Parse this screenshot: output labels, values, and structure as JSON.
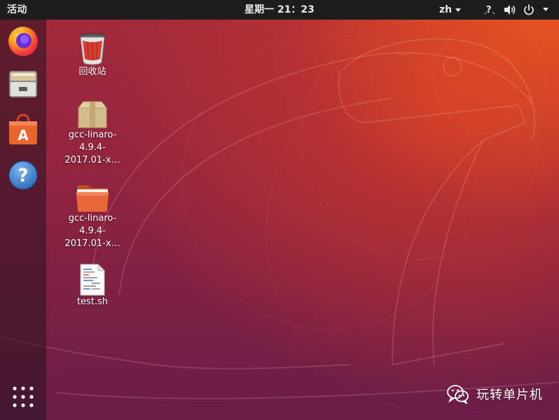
{
  "topbar": {
    "activities_label": "活动",
    "clock": "星期一 21：23",
    "language": "zh",
    "icons": [
      "accessibility-icon",
      "volume-icon",
      "power-icon",
      "system-menu-chevron-icon"
    ]
  },
  "dock": {
    "items": [
      {
        "name": "firefox",
        "icon": "firefox-icon"
      },
      {
        "name": "files",
        "icon": "file-cabinet-icon"
      },
      {
        "name": "software",
        "icon": "shopping-bag-icon"
      },
      {
        "name": "help",
        "icon": "help-icon"
      }
    ],
    "show_apps_icon": "app-grid-icon"
  },
  "desktop": {
    "icons": [
      {
        "label": "回收站",
        "icon": "trash-icon"
      },
      {
        "label": "gcc-linaro-\n4.9.4-\n2017.01-x…",
        "icon": "archive-box-icon"
      },
      {
        "label": "gcc-linaro-\n4.9.4-\n2017.01-x…",
        "icon": "folder-icon"
      },
      {
        "label": "test.sh",
        "icon": "script-file-icon"
      }
    ]
  },
  "watermark": {
    "text": "玩转单片机",
    "icon": "wechat-icon"
  },
  "colors": {
    "topbar": "#1d1d1d",
    "wallpaper_orange": "#e9541f",
    "wallpaper_purple": "#7a1f45",
    "folder_orange": "#e8683a"
  }
}
